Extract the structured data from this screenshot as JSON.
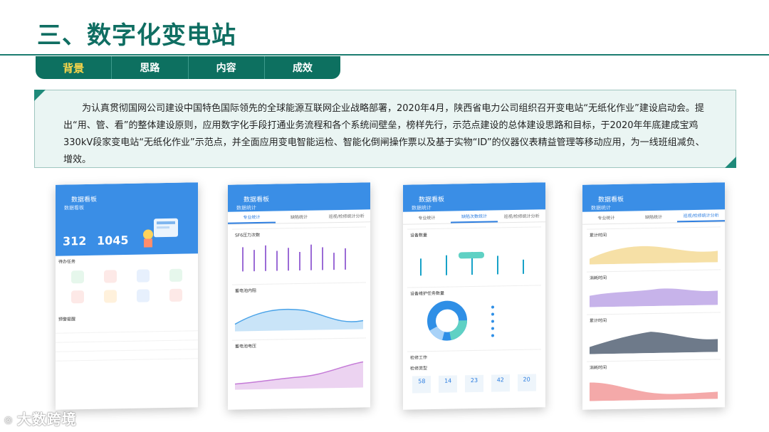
{
  "title": "三、数字化变电站",
  "tabs": [
    "背景",
    "思路",
    "内容",
    "成效"
  ],
  "active_tab": "背景",
  "body_text": "为认真贯彻国网公司建设中国特色国际领先的全球能源互联网企业战略部署，2020年4月，陕西省电力公司组织召开变电站“无纸化作业”建设启动会。提出“用、管、看”的整体建设原则，应用数字化手段打通业务流程和各个系统间壁垒，榜样先行，示范点建设的总体建设思路和目标，于2020年年底建成宝鸡330kV段家变电站“无纸化作业”示范点，并全面应用变电智能运检、智能化倒闸操作票以及基于实物“ID”的仪器仪表精益管理等移动应用，为一线班组减负、增效。",
  "phones": [
    {
      "title": "数据看板",
      "sub": "数据看板",
      "stat1": "312",
      "stat2": "1045",
      "section1": "待办任务",
      "section2": "预警提醒"
    },
    {
      "title": "数据看板",
      "sub": "数据统计",
      "tab1": "专业统计",
      "tab2": "缺陷统计",
      "tab3": "巡视/检修统计分析",
      "c1": "SF6压力次数",
      "c2": "蓄电池内阻",
      "c3": "蓄电池电压"
    },
    {
      "title": "数据看板",
      "sub": "数据统计",
      "tab1": "专业统计",
      "tab2": "缺陷次数统计",
      "tab3": "巡视/检修统计分析",
      "c1": "设备数量",
      "c2": "设备维护任务数量",
      "c3": "检修工作",
      "c3b": "检修类型",
      "nums": [
        "58",
        "14",
        "23",
        "42",
        "20"
      ]
    },
    {
      "title": "数据看板",
      "sub": "数据统计",
      "tab1": "专业统计",
      "tab2": "缺陷统计",
      "tab3": "巡视/检修统计分析",
      "c1": "累计时间",
      "c2": "消耗时间",
      "c3": "累计时间",
      "c4": "消耗时间"
    }
  ],
  "logo_text": "大数跨境"
}
